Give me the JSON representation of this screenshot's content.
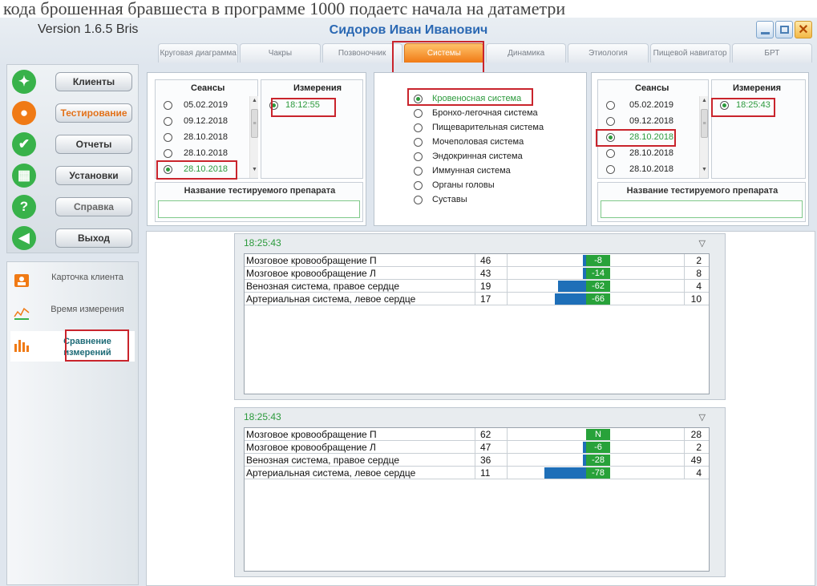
{
  "doc_strip": "кода брошенная бравшеста в программе 1000 подаетс начала на датаметри",
  "window": {
    "version": "Version 1.6.5 Bris",
    "patient": "Сидоров Иван Иванович"
  },
  "tabs": [
    {
      "label": "Круговая диаграмма",
      "active": false
    },
    {
      "label": "Чакры",
      "active": false
    },
    {
      "label": "Позвоночник",
      "active": false
    },
    {
      "label": "Системы",
      "active": true
    },
    {
      "label": "Динамика",
      "active": false
    },
    {
      "label": "Этиология",
      "active": false
    },
    {
      "label": "Пищевой навигатор",
      "active": false
    },
    {
      "label": "БРТ",
      "active": false
    }
  ],
  "sidebar": {
    "main": [
      {
        "label": "Клиенты",
        "icon": "person-icon",
        "color": "#38b24a"
      },
      {
        "label": "Тестирование",
        "icon": "tester-icon",
        "color": "#f07a15"
      },
      {
        "label": "Отчеты",
        "icon": "checkmark-icon",
        "color": "#38b24a"
      },
      {
        "label": "Установки",
        "icon": "settings-grid-icon",
        "color": "#38b24a"
      },
      {
        "label": "Справка",
        "icon": "help-icon",
        "color": "#38b24a"
      },
      {
        "label": "Выход",
        "icon": "exit-arrow-icon",
        "color": "#38b24a"
      }
    ],
    "sub": [
      {
        "label": "Карточка клиента"
      },
      {
        "label": "Время измерения"
      },
      {
        "label": "Сравнение измерений"
      }
    ]
  },
  "left": {
    "sessions_header": "Сеансы",
    "measurements_header": "Измерения",
    "sessions": [
      "05.02.2019",
      "09.12.2018",
      "28.10.2018",
      "28.10.2018",
      "28.10.2018"
    ],
    "selected_session": 4,
    "measurements": [
      "18:12:55"
    ],
    "drug_label": "Название тестируемого препарата"
  },
  "right": {
    "sessions_header": "Сеансы",
    "measurements_header": "Измерения",
    "sessions": [
      "05.02.2019",
      "09.12.2018",
      "28.10.2018",
      "28.10.2018",
      "28.10.2018"
    ],
    "selected_session": 2,
    "measurements": [
      "18:25:43"
    ],
    "drug_label": "Название тестируемого препарата"
  },
  "systems": {
    "items": [
      "Кровеносная система",
      "Бронхо-легочная система",
      "Пищеварительная система",
      "Мочеполовая система",
      "Эндокринная система",
      "Иммунная система",
      "Органы головы",
      "Суставы"
    ],
    "selected": 0
  },
  "results": [
    {
      "time": "18:25:43",
      "rows": [
        {
          "name": "Мозговое кровообращение П",
          "value": "46",
          "delta": "-8",
          "delta_num": -8,
          "count": "2"
        },
        {
          "name": "Мозговое кровообращение Л",
          "value": "43",
          "delta": "-14",
          "delta_num": -14,
          "count": "8"
        },
        {
          "name": "Венозная система, правое сердце",
          "value": "19",
          "delta": "-62",
          "delta_num": -62,
          "count": "4"
        },
        {
          "name": "Артериальная система, левое сердце",
          "value": "17",
          "delta": "-66",
          "delta_num": -66,
          "count": "10"
        }
      ]
    },
    {
      "time": "18:25:43",
      "rows": [
        {
          "name": "Мозговое кровообращение П",
          "value": "62",
          "delta": "N",
          "delta_num": 0,
          "count": "28"
        },
        {
          "name": "Мозговое кровообращение Л",
          "value": "47",
          "delta": "-6",
          "delta_num": -6,
          "count": "2"
        },
        {
          "name": "Венозная система, правое сердце",
          "value": "36",
          "delta": "-28",
          "delta_num": -28,
          "count": "49"
        },
        {
          "name": "Артериальная система, левое сердце",
          "value": "11",
          "delta": "-78",
          "delta_num": -78,
          "count": "4"
        }
      ]
    }
  ],
  "colors": {
    "accent_green": "#2c9a3c",
    "accent_orange": "#f07a15",
    "bar_blue": "#1e6fb8",
    "highlight_red": "#c9242c"
  }
}
